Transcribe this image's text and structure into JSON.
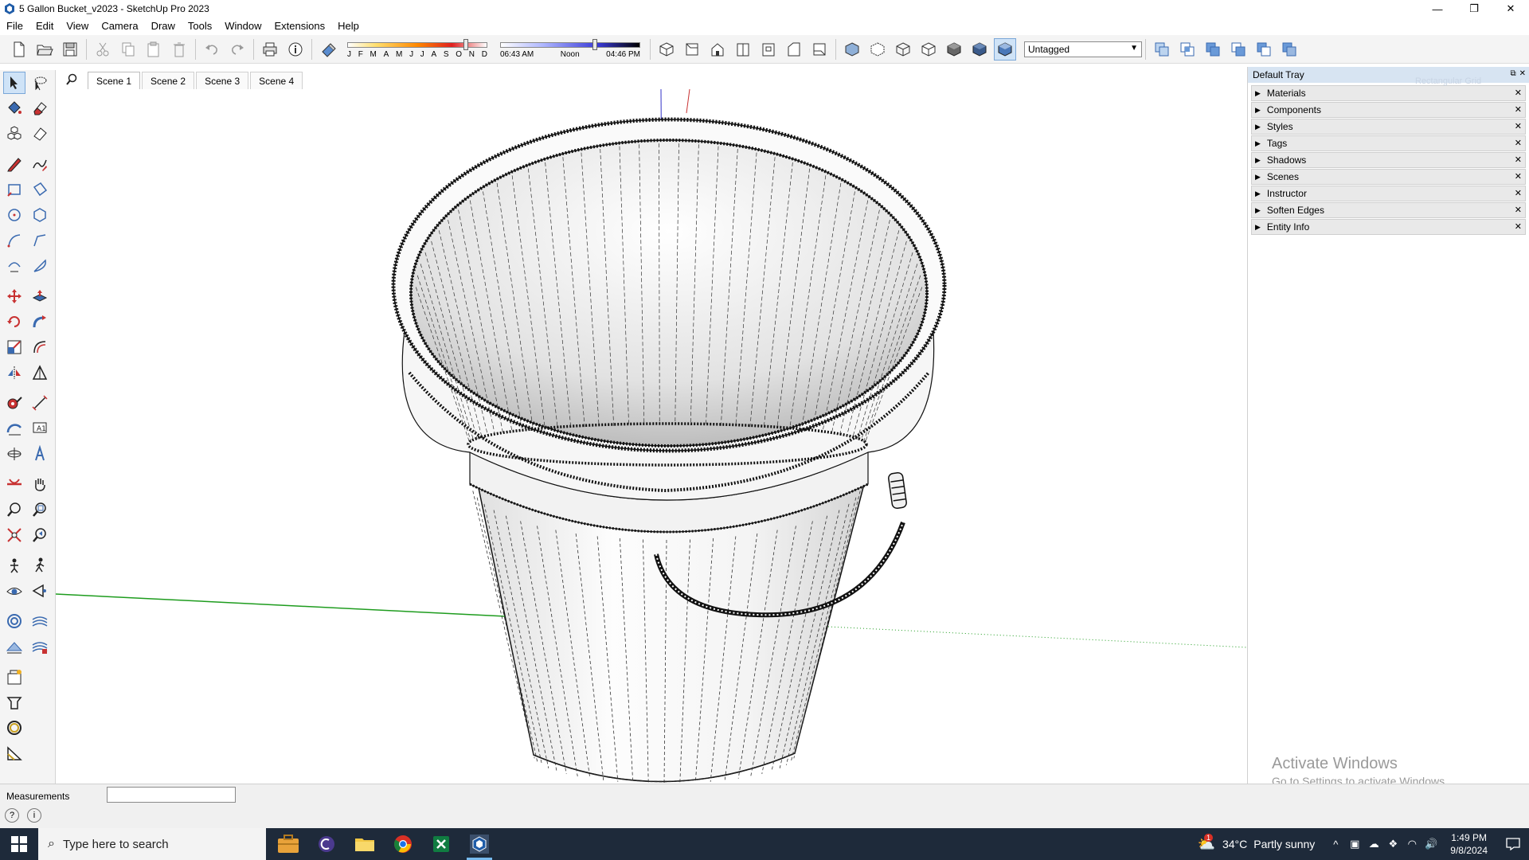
{
  "window": {
    "title": "5 Gallon Bucket_v2023 - SketchUp Pro 2023",
    "minimize": "—",
    "maximize": "❐",
    "close": "✕"
  },
  "menu": [
    "File",
    "Edit",
    "View",
    "Camera",
    "Draw",
    "Tools",
    "Window",
    "Extensions",
    "Help"
  ],
  "toolbar": {
    "months": [
      "J",
      "F",
      "M",
      "A",
      "M",
      "J",
      "J",
      "A",
      "S",
      "O",
      "N",
      "D"
    ],
    "month_slider_value": 0.86,
    "time_start": "06:43 AM",
    "time_noon": "Noon",
    "time_end": "04:46 PM",
    "time_slider_value": 0.68,
    "tag_select": "Untagged"
  },
  "scenes": {
    "tabs": [
      "Scene 1",
      "Scene 2",
      "Scene 3",
      "Scene 4"
    ],
    "active": 0
  },
  "tray": {
    "title": "Default Tray",
    "panels": [
      "Materials",
      "Components",
      "Styles",
      "Tags",
      "Shadows",
      "Scenes",
      "Instructor",
      "Soften Edges",
      "Entity Info"
    ],
    "faded_tooltip": "Rectangular Grid"
  },
  "watermark": {
    "line1": "Activate Windows",
    "line2": "Go to Settings to activate Windows."
  },
  "statusbar": {
    "measurements_label": "Measurements",
    "measurements_value": ""
  },
  "taskbar": {
    "search_placeholder": "Type here to search",
    "weather_temp": "34°C",
    "weather_desc": "Partly sunny",
    "weather_badge": "1",
    "time": "1:49 PM",
    "date": "9/8/2024"
  },
  "colors": {
    "axis_red": "#c83232",
    "axis_green": "#1e9c1e",
    "axis_blue": "#3232c8",
    "tray_header": "#d7e4f2",
    "taskbar_bg": "#1e2a3a"
  }
}
